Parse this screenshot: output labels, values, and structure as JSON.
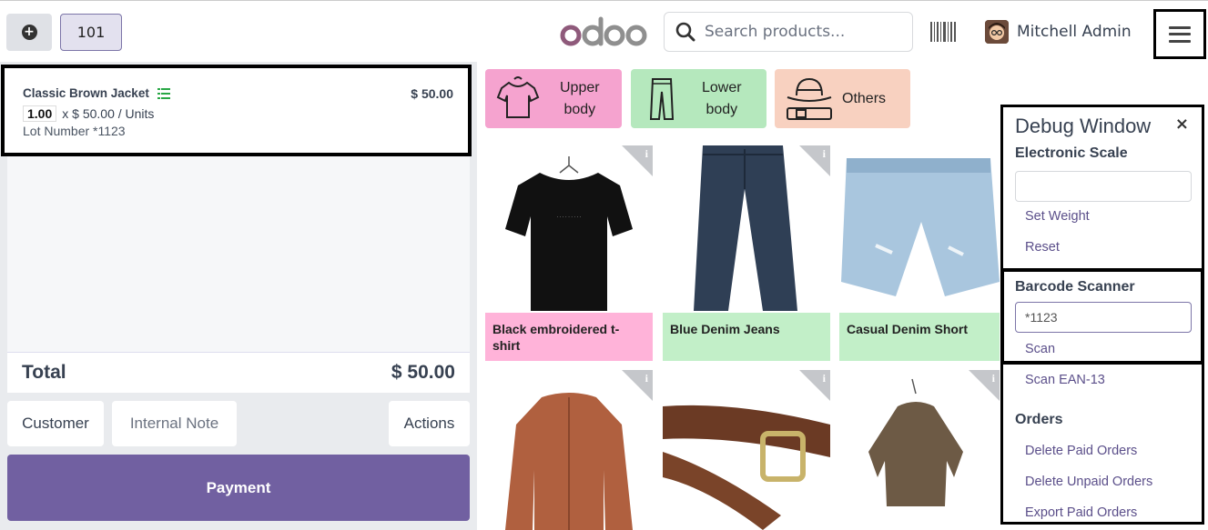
{
  "header": {
    "new_order_symbol": "+",
    "table_number": "101",
    "brand": "odoo",
    "search_placeholder": "Search products...",
    "user_name": "Mitchell Admin"
  },
  "order": {
    "line": {
      "product": "Classic Brown Jacket",
      "price": "$ 50.00",
      "quantity": "1.00",
      "unit_price": "x $ 50.00 / Units",
      "lot": "Lot Number *1123"
    },
    "total_label": "Total",
    "total_value": "$ 50.00",
    "buttons": {
      "customer": "Customer",
      "internal_note": "Internal Note",
      "actions": "Actions",
      "payment": "Payment"
    }
  },
  "categories": [
    {
      "label_line1": "Upper",
      "label_line2": "body",
      "color": "#f5a3cf",
      "icon": "tshirt-icon"
    },
    {
      "label_line1": "Lower",
      "label_line2": "body",
      "color": "#b5e8bd",
      "icon": "pants-icon"
    },
    {
      "label_line1": "Others",
      "label_line2": "",
      "color": "#f8d1c0",
      "icon": "hat-belt-icon"
    }
  ],
  "products": [
    {
      "name": "Black embroidered t-shirt",
      "color": "#ffb3d9"
    },
    {
      "name": "Blue Denim Jeans",
      "color": "#c2efc8"
    },
    {
      "name": "Casual Denim Short",
      "color": "#c2efc8"
    },
    {
      "name": "",
      "color": "#ffffff"
    },
    {
      "name": "",
      "color": "#ffffff"
    },
    {
      "name": "",
      "color": "#ffffff"
    }
  ],
  "debug": {
    "title": "Debug Window",
    "close": "×",
    "scale_section": "Electronic Scale",
    "scale_value": "",
    "set_weight": "Set Weight",
    "reset": "Reset",
    "barcode_section": "Barcode Scanner",
    "barcode_value": "*1123",
    "scan": "Scan",
    "scan_ean": "Scan EAN-13",
    "orders_section": "Orders",
    "delete_paid": "Delete Paid Orders",
    "delete_unpaid": "Delete Unpaid Orders",
    "export_paid": "Export Paid Orders"
  },
  "colors": {
    "accent": "#7160a1",
    "link": "#5b4f8a"
  }
}
